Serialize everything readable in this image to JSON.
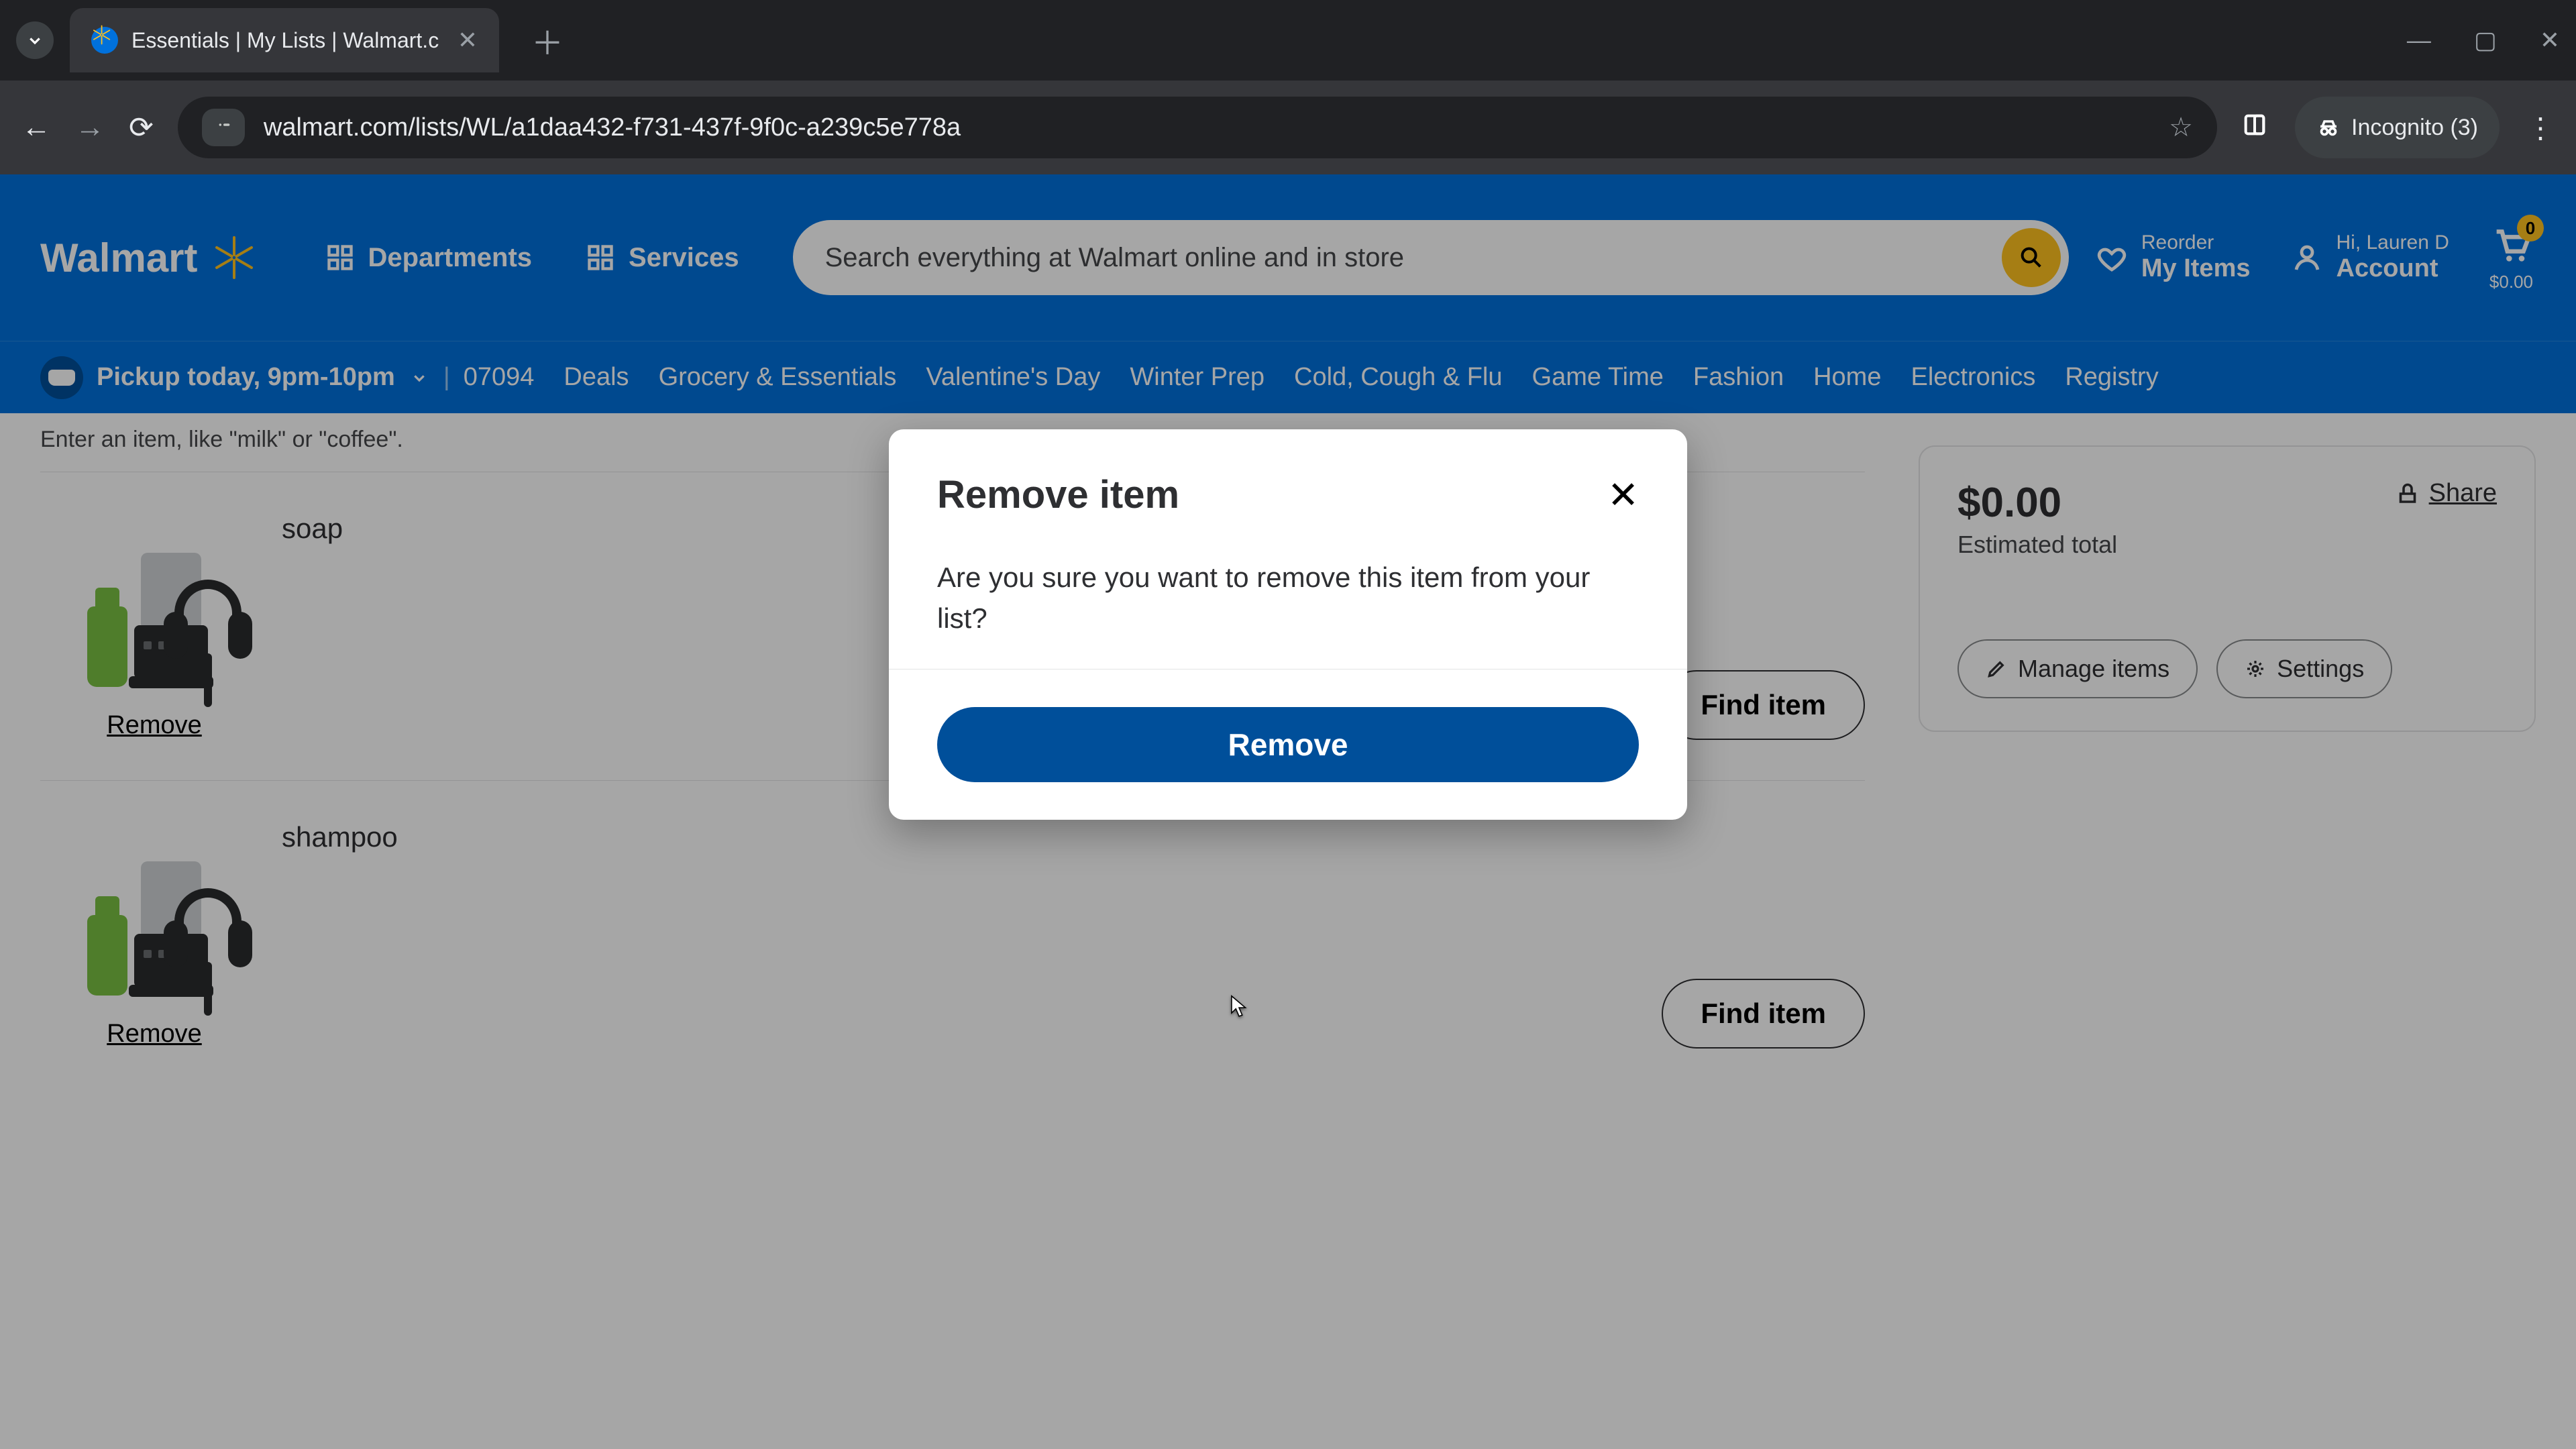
{
  "browser": {
    "tab_title": "Essentials | My Lists | Walmart.c",
    "url": "walmart.com/lists/WL/a1daa432-f731-437f-9f0c-a239c5e778a",
    "incognito_label": "Incognito (3)"
  },
  "header": {
    "logo_text": "Walmart",
    "departments": "Departments",
    "services": "Services",
    "search_placeholder": "Search everything at Walmart online and in store",
    "reorder_small": "Reorder",
    "reorder_big": "My Items",
    "account_small": "Hi, Lauren D",
    "account_big": "Account",
    "cart_count": "0",
    "cart_amount": "$0.00"
  },
  "subnav": {
    "pickup_label": "Pickup today, 9pm-10pm",
    "zip": "07094",
    "links": [
      "Deals",
      "Grocery & Essentials",
      "Valentine's Day",
      "Winter Prep",
      "Cold, Cough & Flu",
      "Game Time",
      "Fashion",
      "Home",
      "Electronics",
      "Registry"
    ]
  },
  "list": {
    "hint": "Enter an item, like \"milk\" or \"coffee\".",
    "remove_label": "Remove",
    "find_label": "Find item",
    "items": [
      {
        "name": "soap"
      },
      {
        "name": "shampoo"
      }
    ]
  },
  "sidebar": {
    "total": "$0.00",
    "est_label": "Estimated total",
    "share": "Share",
    "manage": "Manage items",
    "settings": "Settings"
  },
  "modal": {
    "title": "Remove item",
    "message": "Are you sure you want to remove this item from your list?",
    "confirm": "Remove"
  }
}
